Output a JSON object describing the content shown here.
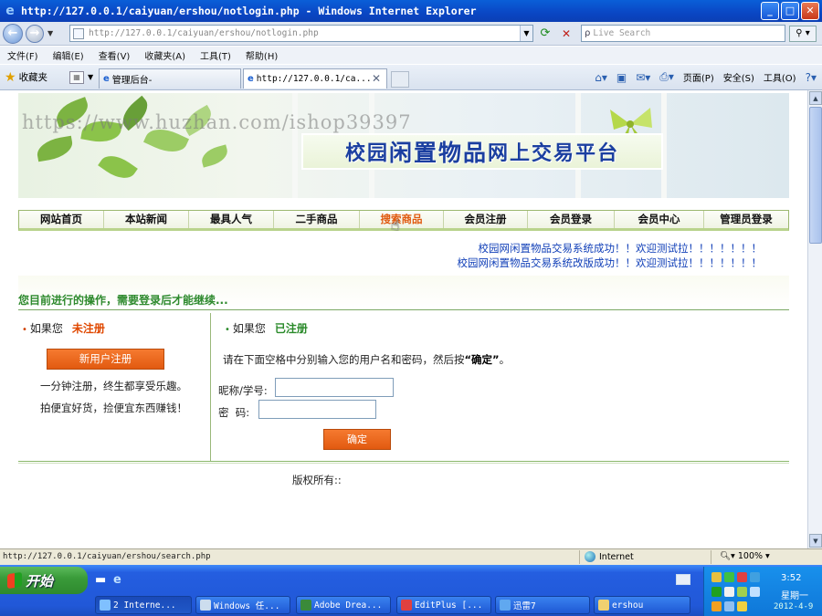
{
  "window": {
    "title": "http://127.0.0.1/caiyuan/ershou/notlogin.php - Windows Internet Explorer",
    "address": "http://127.0.0.1/caiyuan/ershou/notlogin.php",
    "search_placeholder": "Live Search"
  },
  "menu": [
    "文件(F)",
    "编辑(E)",
    "查看(V)",
    "收藏夹(A)",
    "工具(T)",
    "帮助(H)"
  ],
  "favorites_label": "收藏夹",
  "tabs": [
    {
      "label": "管理后台-"
    },
    {
      "label": "http://127.0.0.1/ca..."
    }
  ],
  "commands": {
    "page": "页面(P)",
    "safety": "安全(S)",
    "tools": "工具(O)"
  },
  "banner": {
    "watermark": "https://www.huzhan.com/ishop39397",
    "title_pre": "校园",
    "title_big": "闲置物品",
    "title_post": "网上交易平台"
  },
  "nav": [
    "网站首页",
    "本站新闻",
    "最具人气",
    "二手商品",
    "搜索商品",
    "会员注册",
    "会员登录",
    "会员中心",
    "管理员登录"
  ],
  "announcements": [
    "校园网闲置物品交易系统成功！！欢迎测试拉！！！！！！！",
    "校园网闲置物品交易系统改版成功！！欢迎测试拉！！！！！！！"
  ],
  "notice": "您目前进行的操作，需要登录后才能继续...",
  "left": {
    "prefix": "如果您",
    "status": "未注册",
    "button": "新用户注册",
    "line1": "一分钟注册，终生都享受乐趣。",
    "line2": "拍便宜好货，捡便宜东西赚钱！"
  },
  "right": {
    "prefix": "如果您",
    "status": "已注册",
    "instruction_pre": "请在下面空格中分别输入您的用户名和密码，然后按",
    "instruction_key": "“确定”",
    "instruction_post": "。",
    "nick_label": "昵称/学号:",
    "nick_value": "",
    "pwd_label": "密  码:",
    "pwd_value": "",
    "submit": "确定"
  },
  "copyright": "版权所有::",
  "status": {
    "url": "http://127.0.0.1/caiyuan/ershou/search.php",
    "zone": "Internet",
    "zoom": "100%"
  },
  "taskbar": {
    "start": "开始",
    "items": [
      {
        "label": "2 Interne...",
        "icon": "ie-icon"
      },
      {
        "label": "Windows 任...",
        "icon": "window-icon"
      },
      {
        "label": "Adobe Drea...",
        "icon": "dreamweaver-icon"
      },
      {
        "label": "EditPlus [...",
        "icon": "editplus-icon"
      },
      {
        "label": "迅雷7",
        "icon": "thunder-icon"
      },
      {
        "label": "ershou",
        "icon": "folder-icon"
      }
    ],
    "clock": "3:52",
    "weekday": "星期一",
    "date": "2012-4-9"
  }
}
